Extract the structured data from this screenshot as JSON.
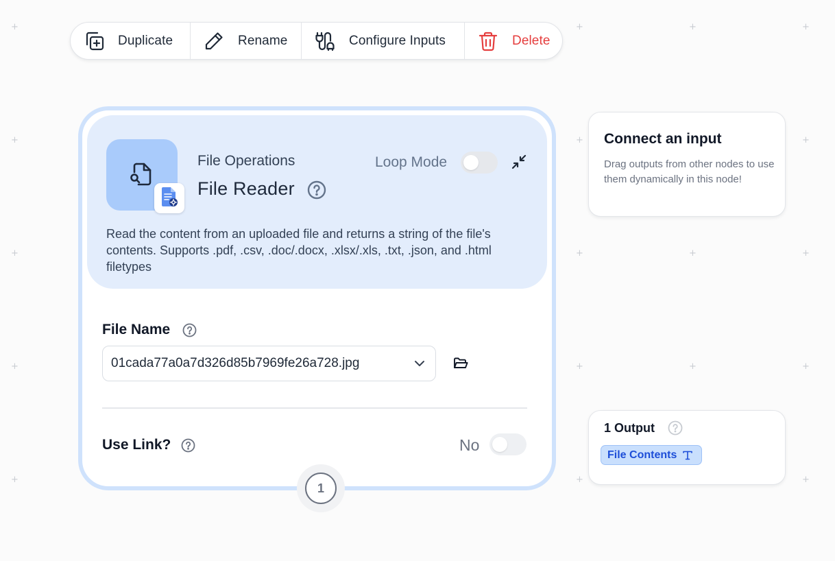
{
  "toolbar": {
    "duplicate_label": "Duplicate",
    "rename_label": "Rename",
    "configure_label": "Configure Inputs",
    "delete_label": "Delete"
  },
  "node": {
    "category": "File Operations",
    "title": "File Reader",
    "loop_mode_label": "Loop Mode",
    "loop_mode_enabled": false,
    "description": "Read the content from an uploaded file and returns a string of the file's contents. Supports .pdf, .csv, .doc/.docx, .xlsx/.xls, .txt, .json, and .html filetypes",
    "fields": {
      "file_name": {
        "label": "File Name",
        "value": "01cada77a0a7d326d85b7969fe26a728.jpg"
      },
      "use_link": {
        "label": "Use Link?",
        "state_label": "No",
        "enabled": false
      }
    },
    "step_number": "1"
  },
  "connect_panel": {
    "title": "Connect an input",
    "description": "Drag outputs from other nodes to use them dynamically in this node!"
  },
  "output_panel": {
    "title": "1 Output",
    "outputs": [
      {
        "label": "File Contents",
        "type_icon": "text-type-icon"
      }
    ]
  },
  "colors": {
    "accent_blue": "#1d4ed8",
    "header_bg": "#e3edfc",
    "node_border": "#cfe2fc",
    "delete_red": "#e53e3e",
    "icon_tile": "#a9cbfb"
  }
}
